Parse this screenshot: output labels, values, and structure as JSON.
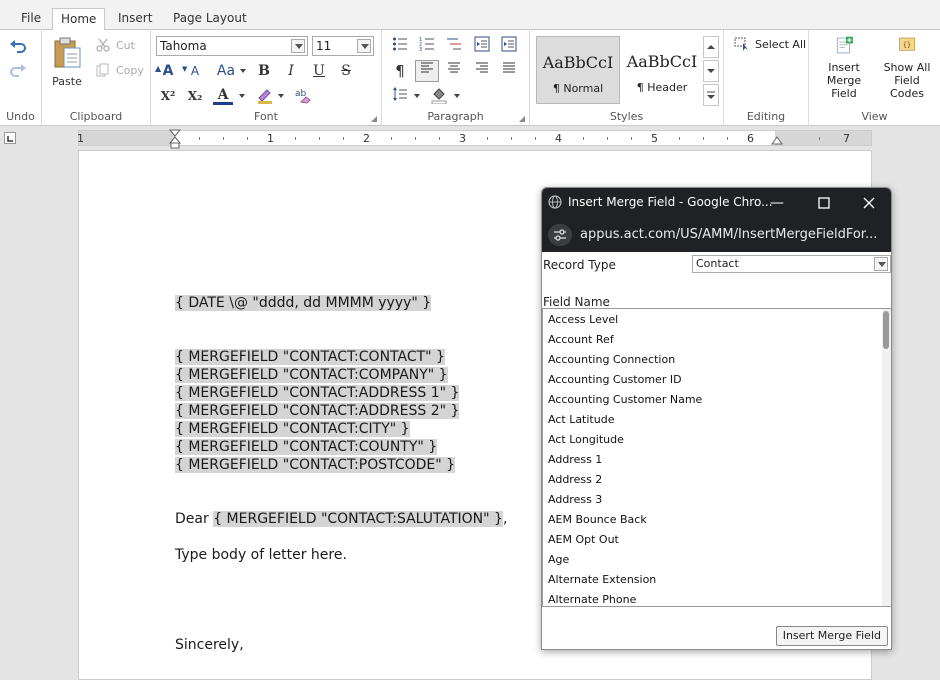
{
  "tabs": [
    "File",
    "Home",
    "Insert",
    "Page Layout"
  ],
  "active_tab": "Home",
  "ribbon": {
    "groups": {
      "undo": "Undo",
      "clipboard": "Clipboard",
      "font": "Font",
      "paragraph": "Paragraph",
      "styles": "Styles",
      "editing": "Editing",
      "view": "View"
    },
    "paste": "Paste",
    "cut": "Cut",
    "copy": "Copy",
    "font_name": "Tahoma",
    "font_size": "11",
    "grow_font": "A",
    "shrink_font": "A",
    "change_case": "Aa",
    "bold": "B",
    "italic": "I",
    "underline": "U",
    "strike": "S",
    "superscript": "X²",
    "subscript": "X₂",
    "font_color_glyph": "A",
    "styles": [
      {
        "sample": "AaBbCcI",
        "name": "¶ Normal"
      },
      {
        "sample": "AaBbCcI",
        "name": "¶ Header"
      }
    ],
    "select_all": "Select All",
    "insert_merge_field": [
      "Insert",
      "Merge Field"
    ],
    "show_all_field_codes": [
      "Show All",
      "Field Codes"
    ]
  },
  "ruler": {
    "numbers": [
      "1",
      "1",
      "2",
      "3",
      "4",
      "5",
      "6",
      "7"
    ]
  },
  "document": {
    "date_field": "{ DATE \\@ \"dddd, dd MMMM yyyy\" }",
    "address_fields": [
      "{ MERGEFIELD \"CONTACT:CONTACT\" }",
      "{ MERGEFIELD \"CONTACT:COMPANY\" }",
      "{ MERGEFIELD \"CONTACT:ADDRESS 1\" }",
      "{ MERGEFIELD \"CONTACT:ADDRESS 2\" }",
      "{ MERGEFIELD \"CONTACT:CITY\" }",
      "{ MERGEFIELD \"CONTACT:COUNTY\" }",
      "{ MERGEFIELD \"CONTACT:POSTCODE\" }"
    ],
    "dear": "Dear ",
    "salutation_field": "{ MERGEFIELD \"CONTACT:SALUTATION\" }",
    "dear_suffix": ",",
    "body": "Type body of letter here.",
    "closing": "Sincerely,"
  },
  "popup": {
    "title": "Insert Merge Field - Google Chro...",
    "url": "appus.act.com/US/AMM/InsertMergeFieldFor...",
    "record_type_label": "Record Type",
    "record_type_value": "Contact",
    "field_name_label": "Field Name",
    "fields": [
      "Access Level",
      "Account Ref",
      "Accounting Connection",
      "Accounting Customer ID",
      "Accounting Customer Name",
      "Act Latitude",
      "Act Longitude",
      "Address 1",
      "Address 2",
      "Address 3",
      "AEM Bounce Back",
      "AEM Opt Out",
      "Age",
      "Alternate Extension",
      "Alternate Phone"
    ],
    "insert_button": "Insert Merge Field"
  }
}
